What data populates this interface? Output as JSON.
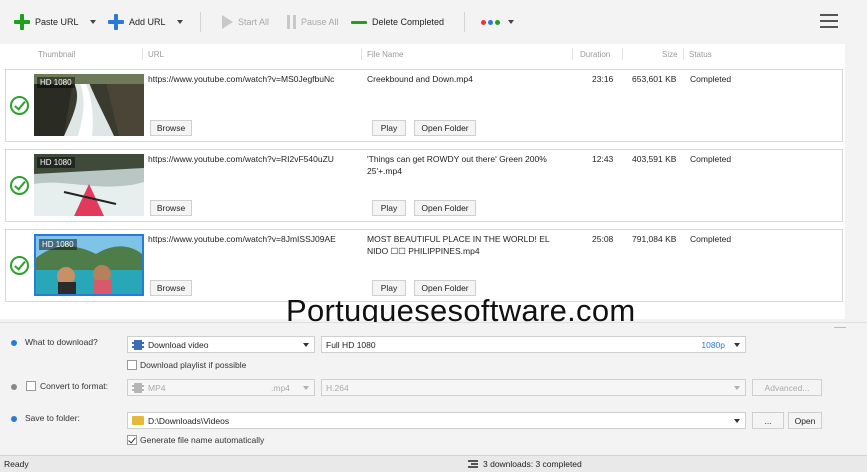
{
  "toolbar": {
    "paste_url": "Paste URL",
    "add_url": "Add URL",
    "start_all": "Start All",
    "pause_all": "Pause All",
    "delete_completed": "Delete Completed",
    "color_dots": [
      "#e53935",
      "#2a7ad9",
      "#1ea11e"
    ]
  },
  "list": {
    "columns": {
      "thumbnail": "Thumbnail",
      "url": "URL",
      "file_name": "File Name",
      "duration": "Duration",
      "size": "Size",
      "status": "Status"
    },
    "rows": [
      {
        "hd": "HD 1080",
        "url": "https://www.youtube.com/watch?v=MS0JegfbuNc",
        "file_name": "Creekbound and Down.mp4",
        "duration": "23:16",
        "size": "653,601 KB",
        "status": "Completed",
        "browse": "Browse",
        "play": "Play",
        "open_folder": "Open Folder"
      },
      {
        "hd": "HD 1080",
        "url": "https://www.youtube.com/watch?v=RI2vF540uZU",
        "file_name": "'Things can get ROWDY out there'  Green 200% 25'+.mp4",
        "duration": "12:43",
        "size": "403,591 KB",
        "status": "Completed",
        "browse": "Browse",
        "play": "Play",
        "open_folder": "Open Folder"
      },
      {
        "hd": "HD 1080",
        "url": "https://www.youtube.com/watch?v=8JmISSJ09AE",
        "file_name": "MOST BEAUTIFUL PLACE IN THE WORLD! EL NIDO ☐☐ PHILIPPINES.mp4",
        "duration": "25:08",
        "size": "791,084 KB",
        "status": "Completed",
        "browse": "Browse",
        "play": "Play",
        "open_folder": "Open Folder"
      }
    ]
  },
  "watermark": "Portuguesesoftware.com",
  "options": {
    "what_to_download_label": "What to download?",
    "download_type": "Download video",
    "quality": "Full HD 1080",
    "quality_badge": "1080p",
    "playlist_label": "Download playlist if possible",
    "convert_label": "Convert to format:",
    "format": "MP4",
    "format_ext": ".mp4",
    "codec": "H.264",
    "advanced": "Advanced...",
    "save_label": "Save to folder:",
    "folder": "D:\\Downloads\\Videos",
    "browse_dots": "...",
    "open": "Open",
    "generate_name_label": "Generate file name automatically"
  },
  "status": {
    "ready": "Ready",
    "summary": "3 downloads: 3 completed"
  }
}
